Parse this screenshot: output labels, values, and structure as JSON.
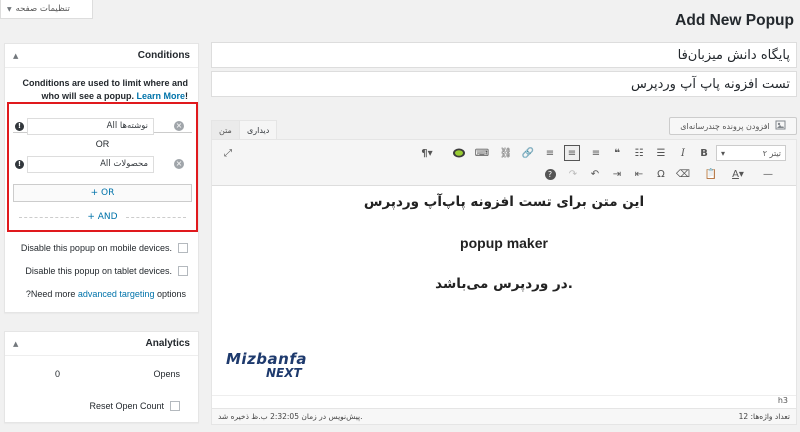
{
  "screen_options": {
    "label": "تنظیمات صفحه"
  },
  "page": {
    "title": "Add New Popup"
  },
  "conditions": {
    "title": "Conditions",
    "description": "Conditions are used to limit where and who will see a popup.",
    "learn_more": "Learn More",
    "description_tail": "!",
    "rule1_value": "All نوشته‌ها",
    "or_label": "OR",
    "rule2_value": "All محصولات",
    "or_add": "+ OR",
    "and_add": "+ AND",
    "mobile_label": "Disable this popup on mobile devices.",
    "tablet_label": "Disable this popup on tablet devices.",
    "targeting_prefix": "?Need more",
    "targeting_link": "advanced targeting",
    "targeting_suffix": "options"
  },
  "analytics": {
    "title": "Analytics",
    "opens_label": "Opens",
    "opens_value": "0",
    "reset_label": "Reset Open Count"
  },
  "editor": {
    "name_value": "پایگاه دانش میزبان‌فا",
    "title_value": "تست افزونه پاپ آپ وردپرس",
    "media_button": "افزودن پرونده چندرسانه‌ای",
    "tab_visual": "دیداری",
    "tab_text": "متن",
    "format_select": "تیتر ۲",
    "content_line1": "این متن برای تست افزونه پاپ‌آپ وردپرس",
    "content_line2": "popup maker",
    "content_line3": "در وردپرس می‌باشد.",
    "logo_name": "Mizbanfa",
    "logo_sub": "NEXT",
    "path": "h3",
    "word_count": "تعداد واژه‌ها: 12",
    "autosave": "پیش‌نویس در زمان 2:32:05 ب.ظ ذخیره شد."
  },
  "colors": {
    "accent": "#0073aa",
    "highlight_box": "#e0191d",
    "logo": "#1e3a6d"
  }
}
